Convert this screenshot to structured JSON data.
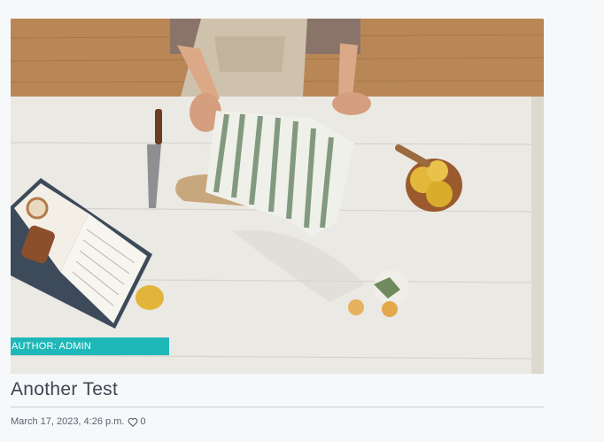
{
  "post": {
    "author_badge": "AUTHOR: ADMIN",
    "title": "Another Test",
    "date": "March 17, 2023, 4:26 p.m.",
    "likes": "0"
  },
  "colors": {
    "badge": "#1fb8b8",
    "title": "#3e4650",
    "meta": "#5a6270",
    "divider": "#c8cbd0"
  },
  "icons": {
    "like": "heart-outline-icon"
  }
}
